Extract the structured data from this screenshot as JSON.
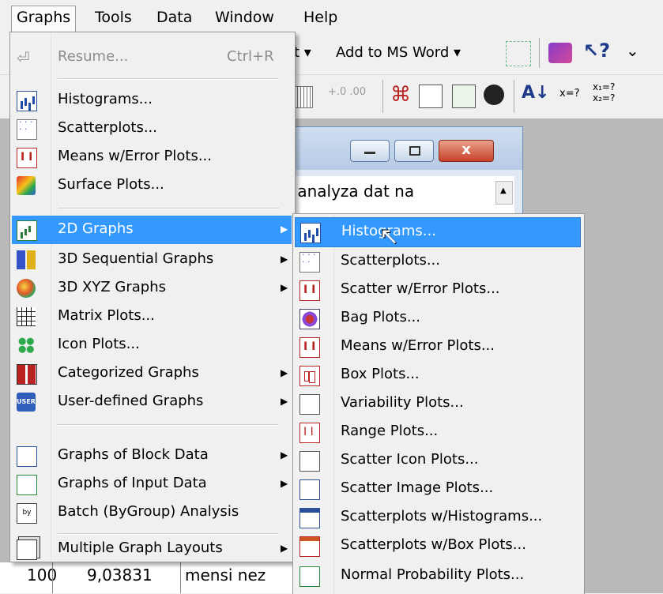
{
  "menubar": {
    "items": [
      "Graphs",
      "Tools",
      "Data",
      "Window",
      "Help"
    ]
  },
  "toolbar": {
    "export_label": "t ▾",
    "add_to_word": "Add to MS Word ▾"
  },
  "child_window": {
    "close_label": "x",
    "sheet_header": "ly - analyza dat na",
    "bottom_row": {
      "num": "100",
      "value": "9,03831",
      "text": "mensi nez"
    }
  },
  "graphs_menu": {
    "items": [
      {
        "label": "Resume...",
        "shortcut": "Ctrl+R",
        "icon": "resume-icon"
      },
      {
        "label": "Histograms...",
        "icon": "histogram-icon"
      },
      {
        "label": "Scatterplots...",
        "icon": "scatterplot-icon"
      },
      {
        "label": "Means w/Error Plots...",
        "icon": "means-error-icon"
      },
      {
        "label": "Surface Plots...",
        "icon": "surface-plot-icon"
      },
      {
        "label": "2D Graphs",
        "icon": "2d-graphs-icon"
      },
      {
        "label": "3D Sequential Graphs",
        "icon": "3d-sequential-icon"
      },
      {
        "label": "3D XYZ Graphs",
        "icon": "3d-xyz-icon"
      },
      {
        "label": "Matrix Plots...",
        "icon": "matrix-plot-icon"
      },
      {
        "label": "Icon Plots...",
        "icon": "icon-plot-icon"
      },
      {
        "label": "Categorized Graphs",
        "icon": "categorized-icon"
      },
      {
        "label": "User-defined Graphs",
        "icon": "user-defined-icon"
      },
      {
        "label": "Graphs of Block Data",
        "icon": "block-data-icon"
      },
      {
        "label": "Graphs of Input Data",
        "icon": "input-data-icon"
      },
      {
        "label": "Batch (ByGroup) Analysis",
        "icon": "batch-icon"
      },
      {
        "label": "Multiple Graph Layouts",
        "icon": "multiple-layouts-icon"
      }
    ]
  },
  "submenu_2d": {
    "items": [
      {
        "label": "Histograms...",
        "icon": "histogram-icon"
      },
      {
        "label": "Scatterplots...",
        "icon": "scatterplot-icon"
      },
      {
        "label": "Scatter w/Error Plots...",
        "icon": "scatter-error-icon"
      },
      {
        "label": "Bag Plots...",
        "icon": "bag-plot-icon"
      },
      {
        "label": "Means w/Error Plots...",
        "icon": "means-error-icon"
      },
      {
        "label": "Box Plots...",
        "icon": "box-plot-icon"
      },
      {
        "label": "Variability Plots...",
        "icon": "variability-icon"
      },
      {
        "label": "Range Plots...",
        "icon": "range-plot-icon"
      },
      {
        "label": "Scatter Icon Plots...",
        "icon": "scatter-icon-plot-icon"
      },
      {
        "label": "Scatter Image Plots...",
        "icon": "scatter-image-icon"
      },
      {
        "label": "Scatterplots w/Histograms...",
        "icon": "scatter-hist-icon"
      },
      {
        "label": "Scatterplots w/Box Plots...",
        "icon": "scatter-box-icon"
      },
      {
        "label": "Normal Probability Plots...",
        "icon": "normal-prob-icon"
      }
    ]
  }
}
